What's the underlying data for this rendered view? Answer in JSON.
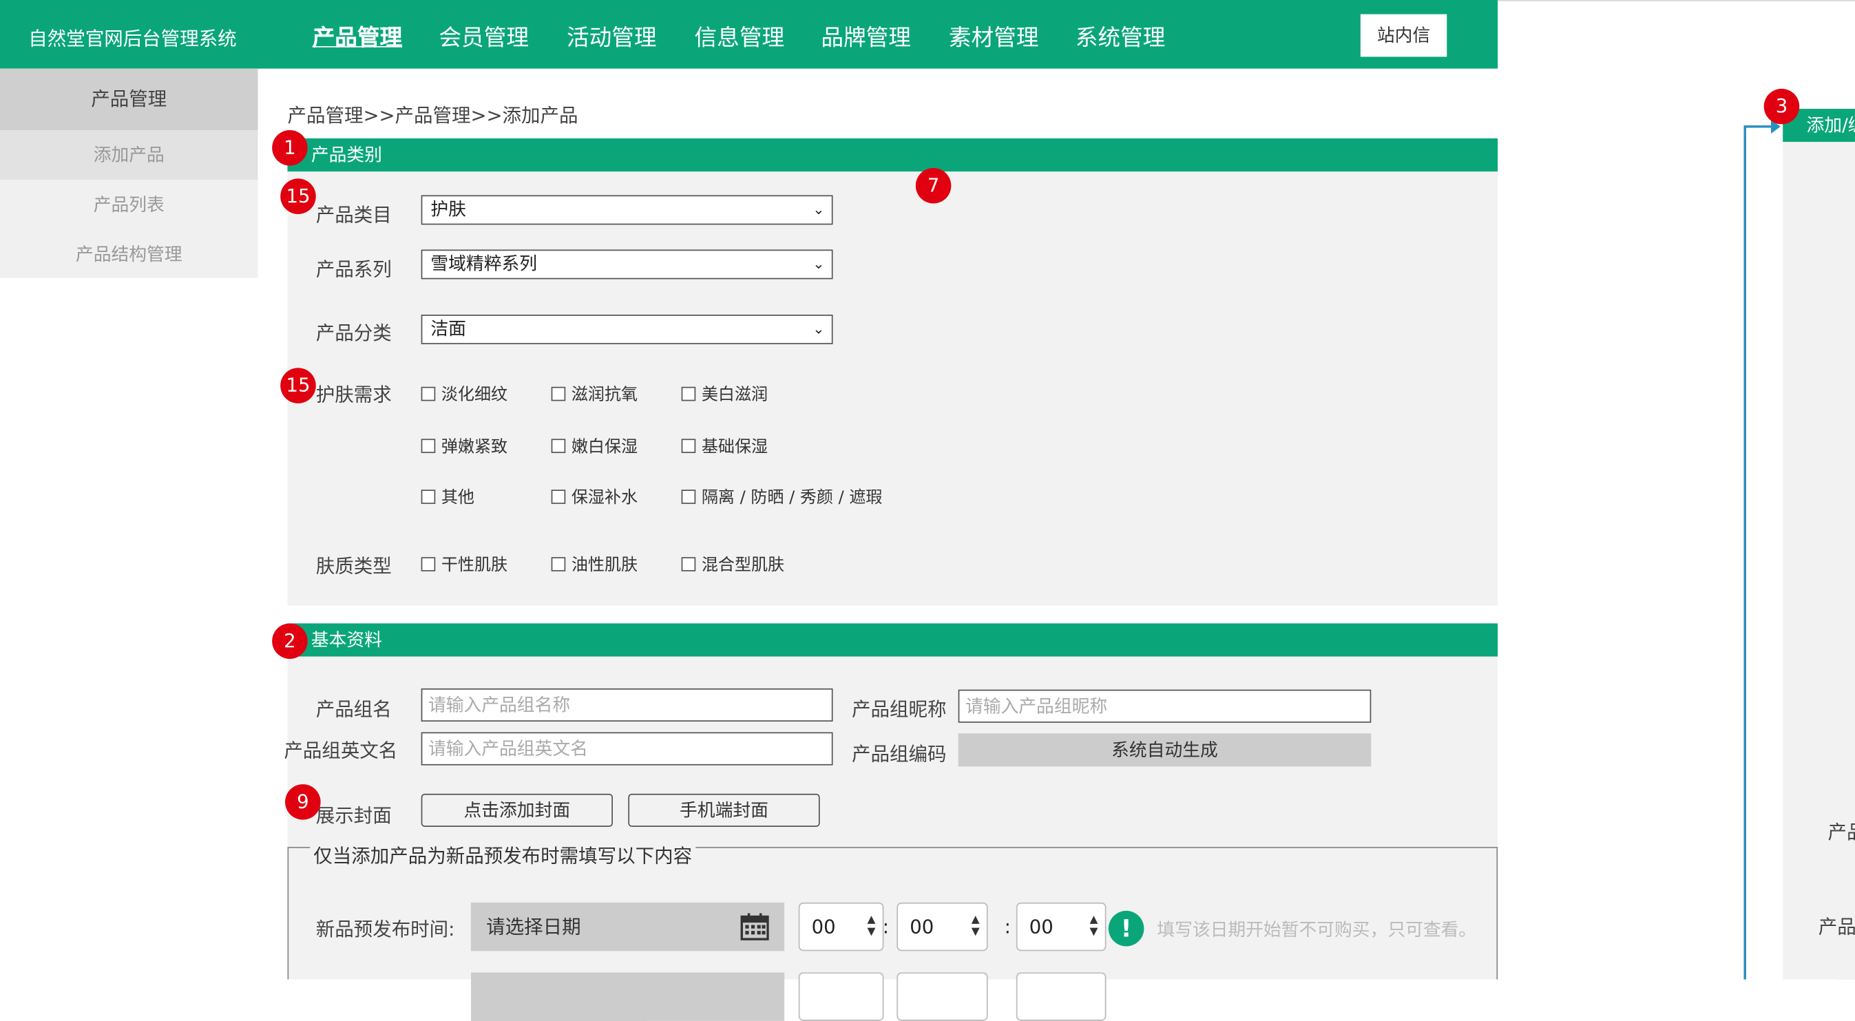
{
  "app": {
    "title": "自然堂官网后台管理系统",
    "inbox_label": "站内信"
  },
  "nav": [
    {
      "label": "产品管理",
      "active": true
    },
    {
      "label": "会员管理"
    },
    {
      "label": "活动管理"
    },
    {
      "label": "信息管理"
    },
    {
      "label": "品牌管理"
    },
    {
      "label": "素材管理"
    },
    {
      "label": "系统管理"
    }
  ],
  "sidebar": {
    "heading": "产品管理",
    "items": [
      {
        "label": "添加产品",
        "selected": true
      },
      {
        "label": "产品列表"
      },
      {
        "label": "产品结构管理"
      }
    ]
  },
  "breadcrumb": "产品管理>>产品管理>>添加产品",
  "category": {
    "section_title": "产品类别",
    "fields": [
      {
        "label": "产品类目",
        "value": "护肤"
      },
      {
        "label": "产品系列",
        "value": "雪域精粹系列"
      },
      {
        "label": "产品分类",
        "value": "洁面"
      }
    ],
    "skin_needs": {
      "label": "护肤需求",
      "options": [
        "淡化细纹",
        "滋润抗氧",
        "美白滋润",
        "弹嫩紧致",
        "嫩白保湿",
        "基础保湿",
        "其他",
        "保湿补水",
        "隔离 / 防晒 / 秀颜 / 遮瑕"
      ]
    },
    "skin_type": {
      "label": "肤质类型",
      "options": [
        "干性肌肤",
        "油性肌肤",
        "混合型肌肤"
      ]
    }
  },
  "basic": {
    "section_title": "基本资料",
    "group_name": {
      "label": "产品组名",
      "placeholder": "请输入产品组名称"
    },
    "group_nickname": {
      "label": "产品组昵称",
      "placeholder": "请输入产品组昵称"
    },
    "group_en_name": {
      "label": "产品组英文名",
      "placeholder": "请输入产品组英文名"
    },
    "group_code": {
      "label": "产品组编码",
      "value": "系统自动生成"
    },
    "cover": {
      "label": "展示封面",
      "add_button": "点击添加封面",
      "mobile_button": "手机端封面"
    }
  },
  "prerelease": {
    "legend": "仅当添加产品为新品预发布时需填写以下内容",
    "label": "新品预发布时间:",
    "date_placeholder": "请选择日期",
    "hour": "00",
    "minute": "00",
    "second": "00",
    "warn_symbol": "!",
    "hint": "填写该日期开始暂不可购买，只可查看。"
  },
  "annotations": [
    "1",
    "15",
    "7",
    "15",
    "2",
    "9",
    "3"
  ],
  "right_panel": {
    "title": "添加/编",
    "label_a": "产品",
    "label_b": "产品"
  },
  "colors": {
    "brand_green": "#0aa679",
    "badge_red": "#e0000f",
    "panel_line": "#2a8fc0"
  }
}
